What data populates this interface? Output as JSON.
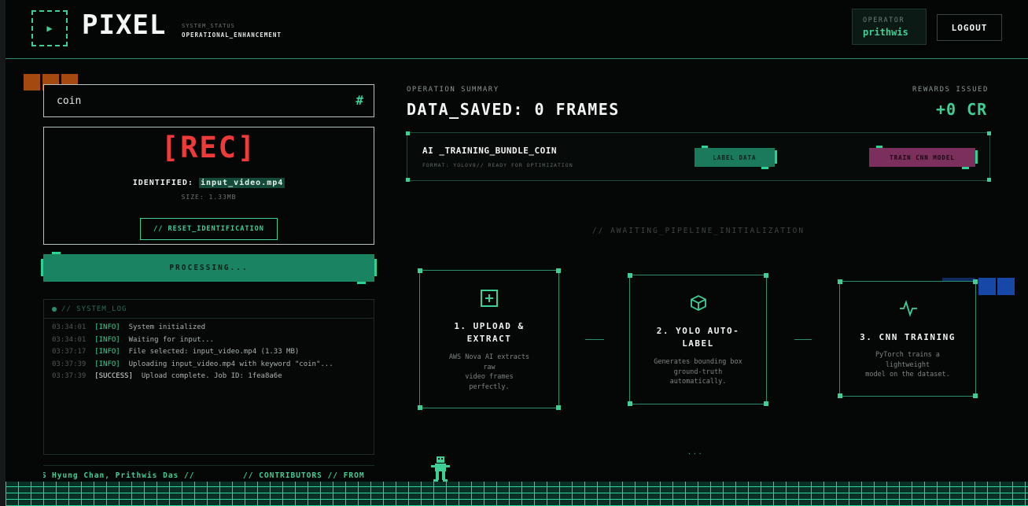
{
  "header": {
    "play_glyph": "▶",
    "brand": "PIXEL",
    "system_status_label": "SYSTEM_STATUS",
    "system_status_value": "OPERATIONAL_ENHANCEMENT",
    "operator_label": "OPERATOR",
    "operator_name": "prithwis",
    "logout_label": "LOGOUT"
  },
  "search": {
    "value": "coin",
    "hash_glyph": "#"
  },
  "recording": {
    "rec_label": "[REC]",
    "identified_label": "IDENTIFIED:",
    "file_name": "input_video.mp4",
    "size_text": "SIZE: 1.33MB",
    "reset_label": "// RESET_IDENTIFICATION",
    "processing_label": "PROCESSING..."
  },
  "system_log": {
    "title": "// SYSTEM_LOG",
    "entries": [
      {
        "time": "03:34:01",
        "tag": "[INFO]",
        "msg": "System initialized"
      },
      {
        "time": "03:34:01",
        "tag": "[INFO]",
        "msg": "Waiting for input..."
      },
      {
        "time": "03:37:17",
        "tag": "[INFO]",
        "msg": "File selected: input_video.mp4 (1.33 MB)"
      },
      {
        "time": "03:37:39",
        "tag": "[INFO]",
        "msg": "Uploading input_video.mp4 with keyword \"coin\"..."
      },
      {
        "time": "03:37:39",
        "tag": "[SUCCESS]",
        "msg": "Upload complete. Job ID: 1fea8a6e"
      }
    ]
  },
  "footer": {
    "marquee_a": "Hyung Chan, Prithwis Das //",
    "marquee_b": "// CONTRIBUTORS // FROM",
    "marquee_c": "S"
  },
  "summary": {
    "operation_label": "OPERATION SUMMARY",
    "data_saved": "DATA_SAVED: 0 FRAMES",
    "rewards_label": "REWARDS ISSUED",
    "rewards_value": "+0 CR"
  },
  "bundle": {
    "title": "AI _TRAINING_BUNDLE_COIN",
    "subtitle": "FORMAT: YOLOV8// READY FOR OPTIMIZATION",
    "label_button": "LABEL DATA",
    "train_button": "TRAIN CNN MODEL"
  },
  "pipeline": {
    "status": "// AWAITING_PIPELINE_INITIALIZATION",
    "dots": "...",
    "steps": [
      {
        "icon": "plus-square-icon",
        "title_1": "1. UPLOAD &",
        "title_2": "EXTRACT",
        "desc_1": "AWS Nova AI extracts",
        "desc_2": "raw",
        "desc_3": "video frames",
        "desc_4": "perfectly."
      },
      {
        "icon": "cube-icon",
        "title_1": "2. YOLO AUTO-",
        "title_2": "LABEL",
        "desc_1": "Generates bounding box",
        "desc_2": "ground-truth",
        "desc_3": "automatically."
      },
      {
        "icon": "pulse-icon",
        "title_1": "3. CNN TRAINING",
        "desc_1": "PyTorch trains a",
        "desc_2": "lightweight",
        "desc_3": "model on the dataset."
      }
    ]
  },
  "colors": {
    "accent": "#3ecf96",
    "rec": "#ef3a3a",
    "label_button": "#1a7a5b",
    "train_button": "#7a2f5c",
    "processing": "#1a8361"
  }
}
